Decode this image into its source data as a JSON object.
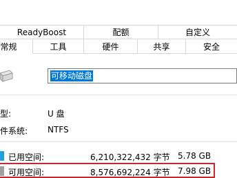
{
  "tabs_top": [
    "ReadyBoost",
    "配额",
    "自定义"
  ],
  "tabs_bottom": [
    "常规",
    "工具",
    "硬件",
    "共享",
    "安全"
  ],
  "drive_name": "可移动磁盘",
  "info": [
    {
      "label": "型:",
      "value": "U 盘"
    },
    {
      "label": "件系统:",
      "value": "NTFS"
    }
  ],
  "space": {
    "used": {
      "label": "已用空间:",
      "bytes": "6,210,322,432 字节",
      "size": "5.78 GB",
      "color": "#26a0da"
    },
    "free": {
      "label": "可用空间:",
      "bytes": "8,576,692,224 字节",
      "size": "7.98 GB",
      "color": "#a0a0a0"
    }
  },
  "highlight_color": "#c8282d"
}
